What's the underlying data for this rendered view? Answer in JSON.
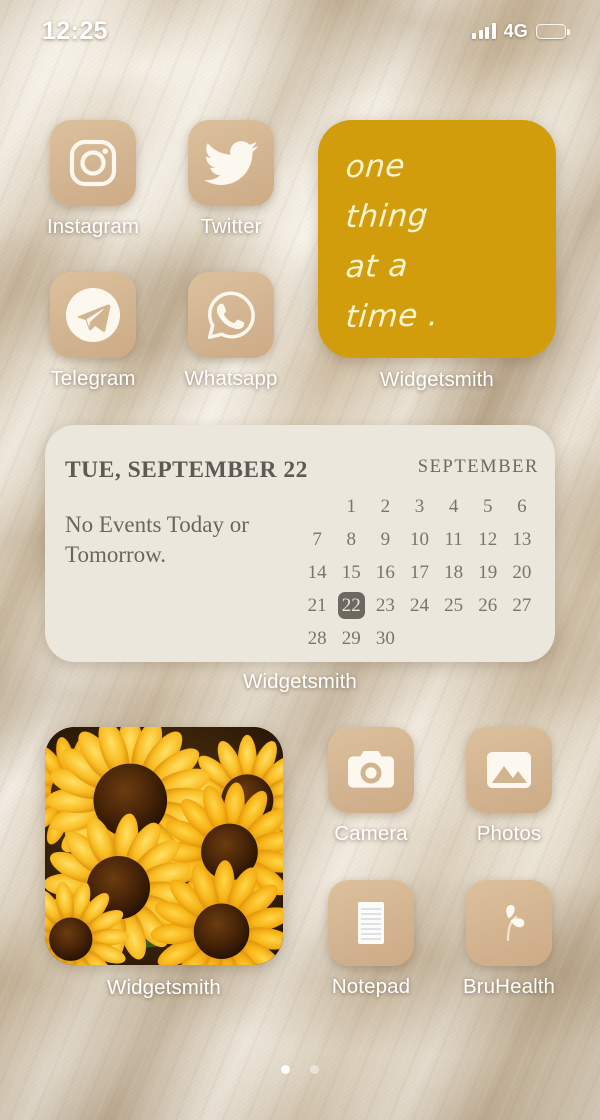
{
  "status_bar": {
    "time": "12:25",
    "network": "4G",
    "signal_icon": "signal-bars-icon",
    "battery_icon": "battery-low-power-icon",
    "battery_level_percent": 46,
    "battery_color": "#f3c91a"
  },
  "theme": {
    "icon_tile_color": "#d3b491",
    "icon_glyph_color": "#fdf8ef",
    "quote_widget_color": "#d29d0d",
    "quote_text_color": "#fbf4cf",
    "calendar_widget_color": "#ece7dd",
    "calendar_text_color": "#6a665f",
    "calendar_today_color": "#6d6961",
    "label_color": "#ffffff"
  },
  "apps_row_1": [
    {
      "label": "Instagram",
      "icon": "instagram-icon"
    },
    {
      "label": "Twitter",
      "icon": "twitter-bird-icon"
    }
  ],
  "apps_row_2": [
    {
      "label": "Telegram",
      "icon": "telegram-paper-plane-icon"
    },
    {
      "label": "Whatsapp",
      "icon": "whatsapp-icon"
    }
  ],
  "apps_row_3": [
    {
      "label": "Camera",
      "icon": "camera-icon"
    },
    {
      "label": "Photos",
      "icon": "photos-mountain-icon"
    }
  ],
  "apps_row_4": [
    {
      "label": "Notepad",
      "icon": "notepad-lined-paper-icon"
    },
    {
      "label": "BruHealth",
      "icon": "sprout-leaf-icon"
    }
  ],
  "quote_widget": {
    "label": "Widgetsmith",
    "lines": [
      "one",
      "thing",
      "at a",
      "time ."
    ]
  },
  "calendar_widget": {
    "label": "Widgetsmith",
    "date_heading": "TUE, SEPTEMBER 22",
    "events_text": "No Events Today or Tomorrow.",
    "month_heading": "SEPTEMBER",
    "leading_blanks": 1,
    "today": 22,
    "days": [
      1,
      2,
      3,
      4,
      5,
      6,
      7,
      8,
      9,
      10,
      11,
      12,
      13,
      14,
      15,
      16,
      17,
      18,
      19,
      20,
      21,
      22,
      23,
      24,
      25,
      26,
      27,
      28,
      29,
      30
    ]
  },
  "photo_widget": {
    "label": "Widgetsmith",
    "image": "sunflowers-photo"
  },
  "page_indicator": {
    "total": 2,
    "active": 1
  }
}
